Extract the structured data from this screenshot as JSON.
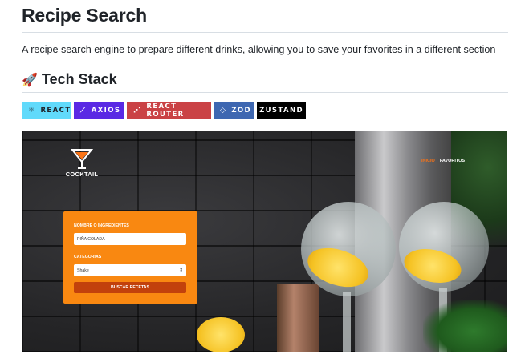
{
  "page": {
    "title": "Recipe Search",
    "description": "A recipe search engine to prepare different drinks, allowing you to save your favorites in a different section",
    "tech_heading": "Tech Stack",
    "tech_icon": "rocket-icon"
  },
  "badges": [
    {
      "label": "REACT",
      "icon": "react-icon",
      "color": "#61dafb"
    },
    {
      "label": "AXIOS",
      "icon": "axios-icon",
      "color": "#5a29e4"
    },
    {
      "label": "REACT ROUTER",
      "icon": "react-router-icon",
      "color": "#ca4245"
    },
    {
      "label": "ZOD",
      "icon": "zod-icon",
      "color": "#3e67b1"
    },
    {
      "label": "ZUSTAND",
      "color": "#000000"
    }
  ],
  "screenshot": {
    "logo_text": "COCKTAIL",
    "nav": {
      "inicio": "INICIO",
      "favoritos": "FAVORITOS"
    },
    "form": {
      "name_label": "NOMBRE O INGREDIENTES",
      "name_value": "PIÑA COLADA",
      "category_label": "CATEGORIAS",
      "category_value": "Shake",
      "submit_label": "BUSCAR RECETAS"
    },
    "colors": {
      "accent": "#f98811",
      "button": "#c2410c"
    }
  }
}
